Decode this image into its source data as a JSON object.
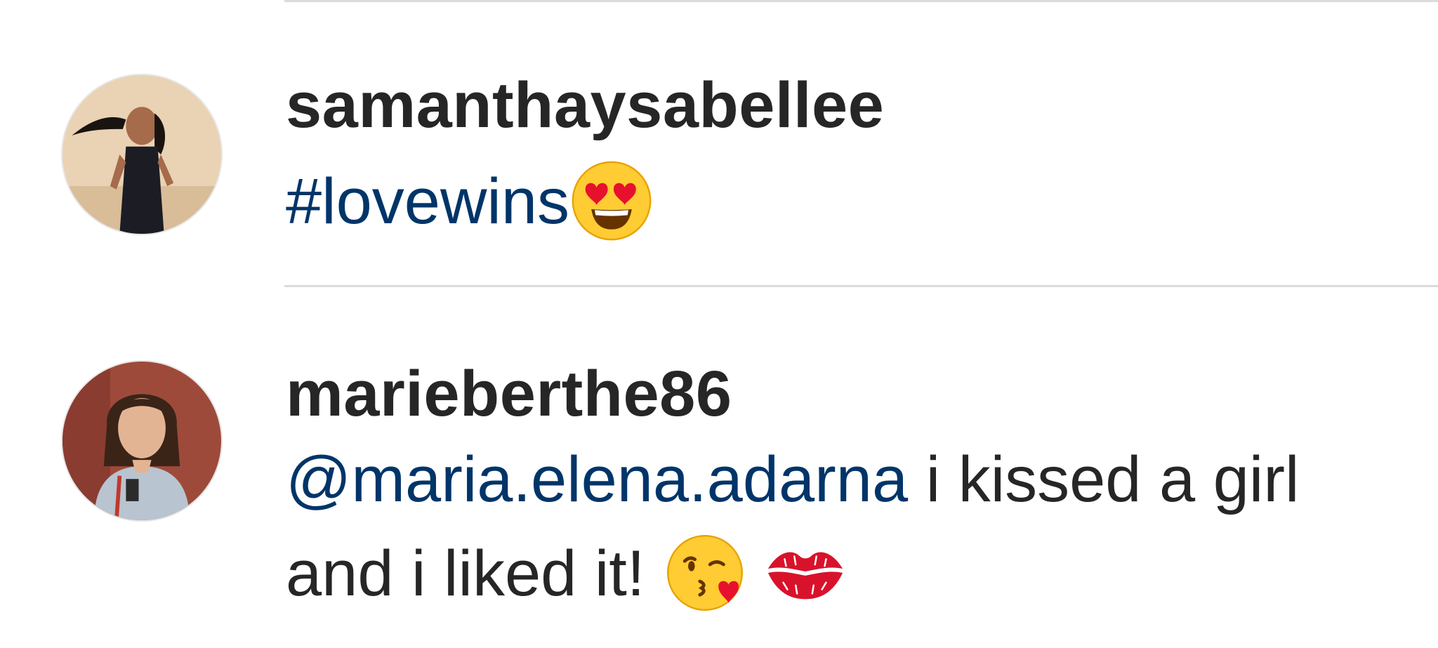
{
  "comments": [
    {
      "username": "samanthaysabellee",
      "avatar_icon": "user-avatar-photo",
      "parts": {
        "link": "#lovewins",
        "text": ""
      },
      "emojis": [
        "heart-eyes-emoji"
      ]
    },
    {
      "username": "marieberthe86",
      "avatar_icon": "user-avatar-photo",
      "parts": {
        "mention": "@maria.elena.adarna",
        "text": " i kissed a girl and i liked it! "
      },
      "emojis": [
        "kissing-heart-emoji",
        "kiss-mark-emoji"
      ]
    }
  ],
  "colors": {
    "text": "#262626",
    "link": "#003569",
    "divider": "#dbdbdb"
  }
}
